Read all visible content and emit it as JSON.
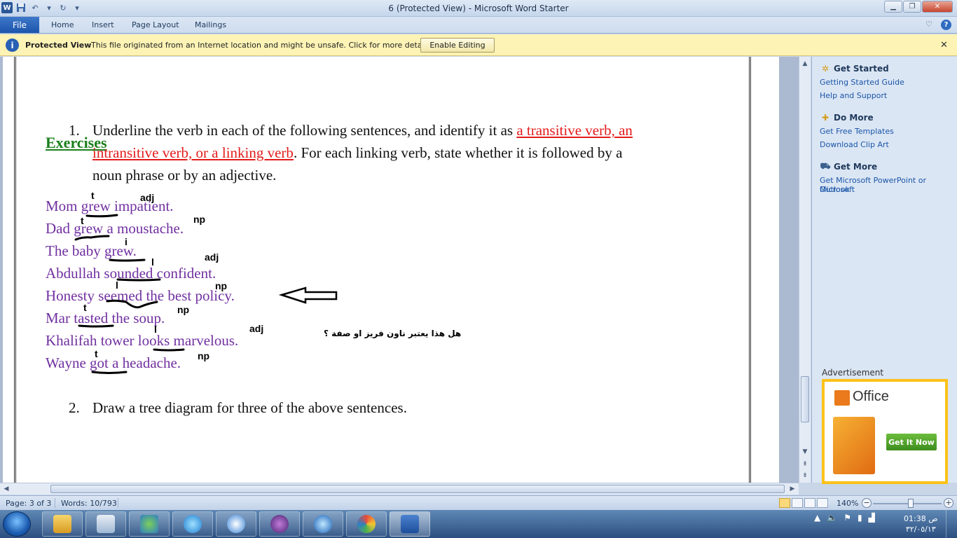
{
  "window": {
    "title": "6 (Protected View)  -  Microsoft Word Starter"
  },
  "ribbon": {
    "file": "File",
    "tabs": [
      "Home",
      "Insert",
      "Page Layout",
      "Mailings"
    ]
  },
  "protected_view": {
    "title": "Protected View",
    "message": "This file originated from an Internet location and might be unsafe. Click for more details.",
    "enable_button": "Enable Editing"
  },
  "document": {
    "heading": "Exercises",
    "q1": {
      "number": "1.",
      "line1_a": "Underline the verb in each of the following sentences, and identify it as ",
      "line1_b": "a transitive verb, an",
      "line2_a": "intransitive verb, or a linking verb",
      "line2_b": ". For each linking verb, state whether it is followed by a",
      "line3": "noun phrase or by an adjective."
    },
    "sentences": [
      "Mom grew impatient.",
      "Dad grew a moustache.",
      "The baby grew.",
      "Abdullah sounded confident.",
      "Honesty seemed the best policy.",
      "Mar tasted the soup.",
      "Khalifah tower looks marvelous.",
      "Wayne got a headache."
    ],
    "annotations": {
      "a1": "t",
      "a2": "adj",
      "a3": "t",
      "a4": "np",
      "a5": "i",
      "a6": "l",
      "a7": "adj",
      "a8": "l",
      "a9": "np",
      "a10": "t",
      "a11": "np",
      "a12": "l",
      "a13": "adj",
      "a14": "t",
      "a15": "np"
    },
    "arabic_note": "هل هذا يعتبر ناون فريز او صفة ؟",
    "q2": {
      "number": "2.",
      "text": "Draw a tree diagram for three of the above sentences."
    }
  },
  "side_pane": {
    "get_started": "Get Started",
    "getting_started_guide": "Getting Started Guide",
    "help_support": "Help and Support",
    "do_more": "Do More",
    "free_templates": "Get Free Templates",
    "clip_art": "Download Clip Art",
    "get_more": "Get More",
    "get_more_link_1": "Get Microsoft PowerPoint or Microsoft",
    "get_more_link_2": "Outlook",
    "ad_label": "Advertisement",
    "ad_brand": "Office",
    "ad_button": "Get It Now"
  },
  "status_bar": {
    "page": "Page: 3 of 3",
    "words": "Words: 10/793",
    "zoom": "140%"
  },
  "taskbar": {
    "time": "01:38 ص",
    "date": "٣٢/٠٥/١٣"
  },
  "colors": {
    "heading": "#1a7f1a",
    "sentences": "#7030a0",
    "red_highlight": "#e31b1b",
    "file_tab": "#1c55ab",
    "pv_bar": "#fdf3b5"
  }
}
